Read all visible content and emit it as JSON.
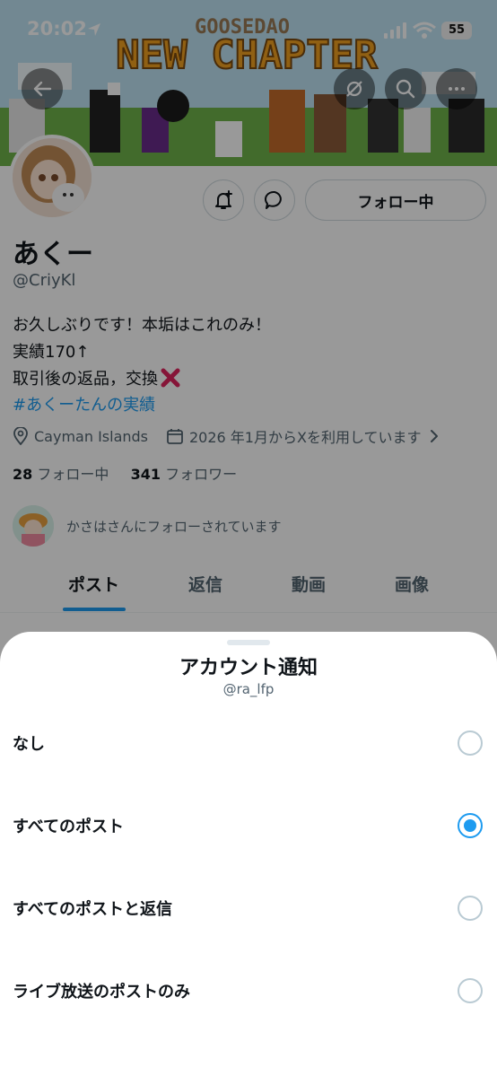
{
  "status_bar": {
    "time": "20:02",
    "battery": "55"
  },
  "banner": {
    "top_text": "GOOSEDAO",
    "main_text": "NEW CHAPTER"
  },
  "profile": {
    "follow_button": "フォロー中",
    "display_name": "あくー",
    "handle": "@CriyKl",
    "bio": [
      "お久しぶりです！本垢はこれのみ！",
      "実績170↑",
      "取引後の返品，交換",
      "#あくーたんの実績"
    ],
    "location": "Cayman Islands",
    "joined": "2026 年1月からXを利用しています",
    "following_count": "28",
    "following_label": "フォロー中",
    "followers_count": "341",
    "followers_label": "フォロワー",
    "followed_by": "かさはさんにフォローされています"
  },
  "tabs": [
    "ポスト",
    "返信",
    "動画",
    "画像"
  ],
  "sheet": {
    "title": "アカウント通知",
    "subtitle": "@ra_lfp",
    "options": [
      {
        "label": "なし",
        "selected": false
      },
      {
        "label": "すべてのポスト",
        "selected": true
      },
      {
        "label": "すべてのポストと返信",
        "selected": false
      },
      {
        "label": "ライブ放送のポストのみ",
        "selected": false
      }
    ]
  },
  "colors": {
    "accent": "#1d9bf0",
    "text": "#0f1419",
    "secondary": "#536471",
    "cross": "#e0245e"
  },
  "icons": [
    "location-arrow-icon",
    "signal-icon",
    "wifi-icon",
    "back-arrow-icon",
    "grok-icon",
    "search-icon",
    "more-icon",
    "bell-plus-icon",
    "message-icon",
    "location-pin-icon",
    "calendar-icon",
    "chevron-right-icon",
    "cross-mark-icon"
  ]
}
